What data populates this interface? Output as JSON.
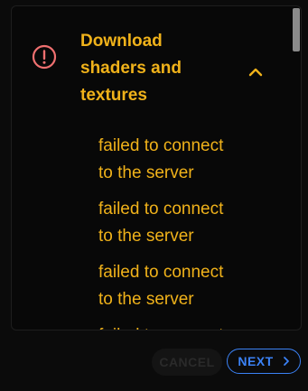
{
  "step": {
    "title": "Download shaders and textures",
    "status_icon": "error-circle-icon",
    "expand_icon": "chevron-up-icon"
  },
  "messages": [
    "failed to connect\nto the server",
    "failed to connect\nto the server",
    "failed to connect\nto the server",
    "failed to connect\nto the server"
  ],
  "footer": {
    "cancel_label": "CANCEL",
    "next_label": "NEXT",
    "next_icon": "chevron-right-icon"
  },
  "colors": {
    "accent": "#f0b21a",
    "error": "#f07070",
    "primary": "#3b82f6",
    "background": "#0b0b0b"
  }
}
